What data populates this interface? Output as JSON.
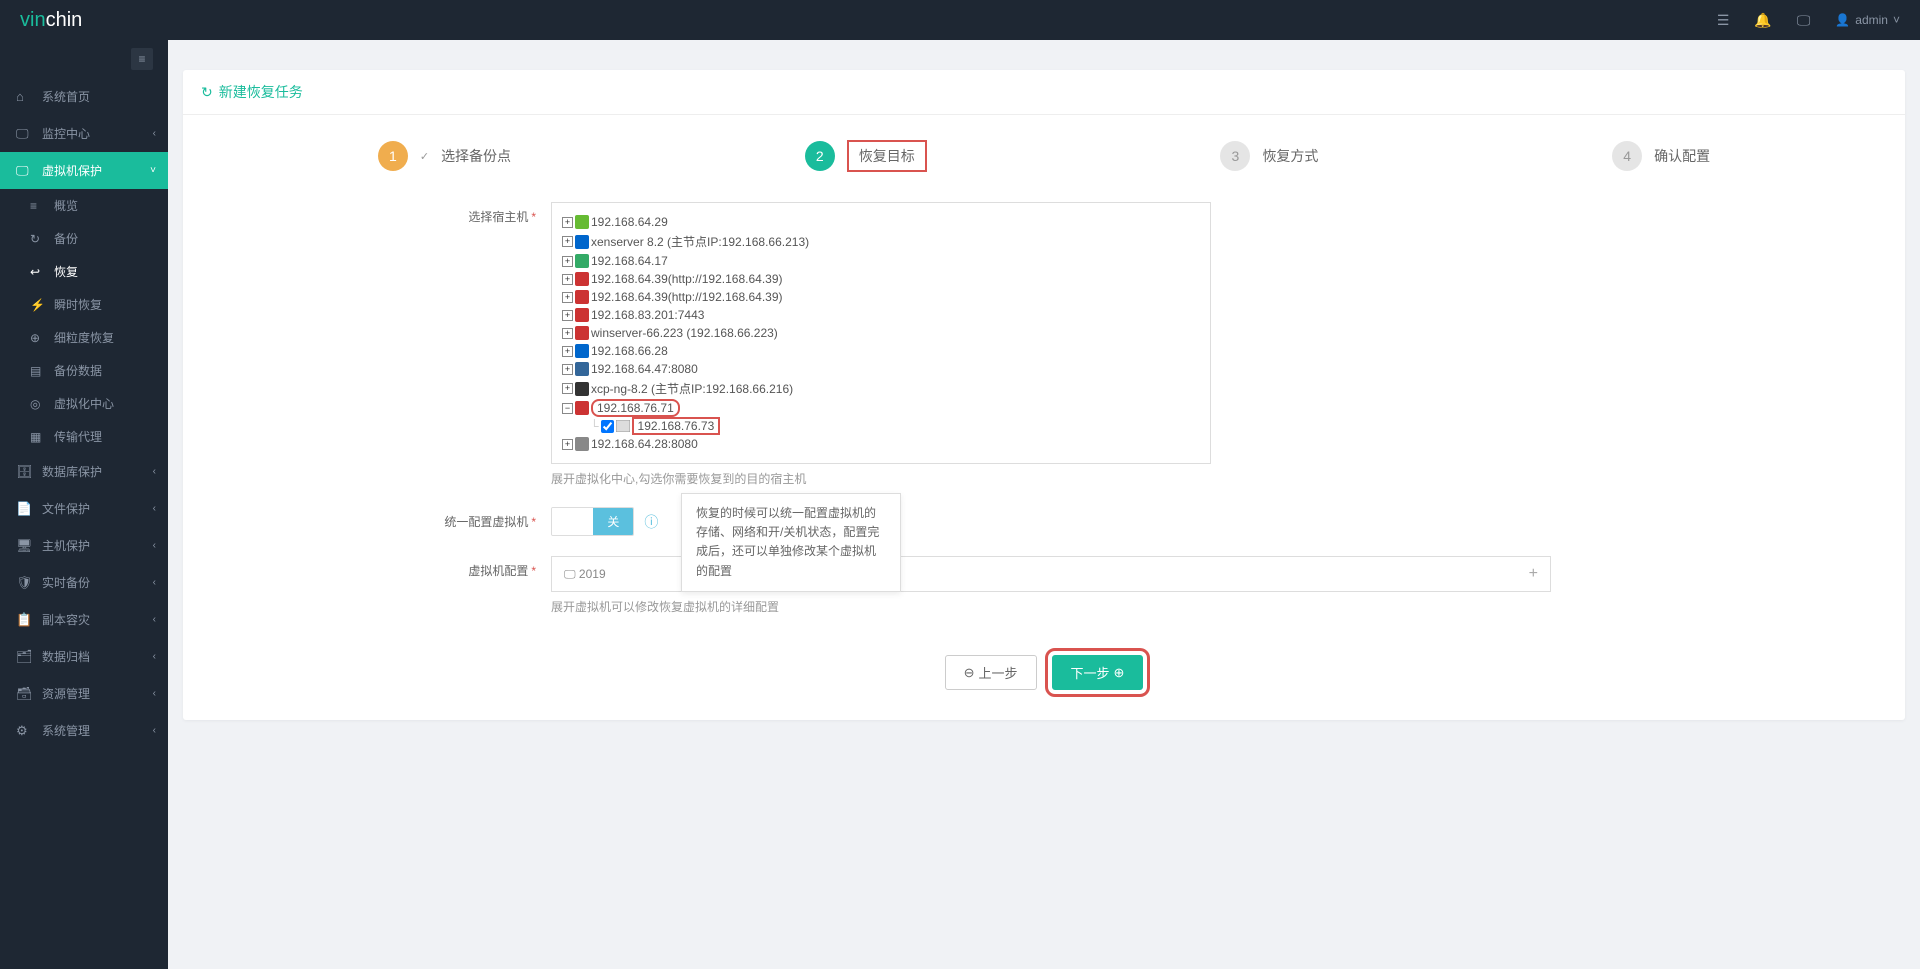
{
  "header": {
    "logo_a": "vin",
    "logo_b": "chin",
    "user": "admin"
  },
  "sidebar": {
    "items": [
      {
        "icon": "home",
        "label": "系统首页"
      },
      {
        "icon": "monitor",
        "label": "监控中心",
        "chevron": "‹"
      },
      {
        "icon": "monitor",
        "label": "虚拟机保护",
        "chevron": "˅",
        "active": true
      },
      {
        "icon": "db",
        "label": "数据库保护",
        "chevron": "‹"
      },
      {
        "icon": "doc",
        "label": "文件保护",
        "chevron": "‹"
      },
      {
        "icon": "host",
        "label": "主机保护",
        "chevron": "‹"
      },
      {
        "icon": "shield",
        "label": "实时备份",
        "chevron": "‹"
      },
      {
        "icon": "copy",
        "label": "副本容灾",
        "chevron": "‹"
      },
      {
        "icon": "archive",
        "label": "数据归档",
        "chevron": "‹"
      },
      {
        "icon": "res",
        "label": "资源管理",
        "chevron": "‹"
      },
      {
        "icon": "gear",
        "label": "系统管理",
        "chevron": "‹"
      }
    ],
    "submenu": [
      {
        "icon": "≡",
        "label": "概览"
      },
      {
        "icon": "↻",
        "label": "备份"
      },
      {
        "icon": "↩",
        "label": "恢复",
        "active": true
      },
      {
        "icon": "⚡",
        "label": "瞬时恢复"
      },
      {
        "icon": "⊕",
        "label": "细粒度恢复"
      },
      {
        "icon": "▤",
        "label": "备份数据"
      },
      {
        "icon": "◎",
        "label": "虚拟化中心"
      },
      {
        "icon": "▦",
        "label": "传输代理"
      }
    ]
  },
  "page_title": "新建恢复任务",
  "steps": [
    {
      "num": "1",
      "label": "选择备份点",
      "done": true
    },
    {
      "num": "2",
      "label": "恢复目标",
      "active": true,
      "highlight": true
    },
    {
      "num": "3",
      "label": "恢复方式"
    },
    {
      "num": "4",
      "label": "确认配置"
    }
  ],
  "form": {
    "host_label": "选择宿主机",
    "config_label": "统一配置虚拟机",
    "vm_label": "虚拟机配置",
    "toggle_off": "关",
    "tooltip": "恢复的时候可以统一配置虚拟机的存储、网络和开/关机状态，配置完成后，还可以单独修改某个虚拟机的配置",
    "host_hint": "展开虚拟化中心,勾选你需要恢复到的目的宿主机",
    "vm_hint": "展开虚拟机可以修改恢复虚拟机的详细配置",
    "vm_item": "2019"
  },
  "tree": [
    {
      "label": "192.168.64.29"
    },
    {
      "label": "xenserver 8.2 (主节点IP:192.168.66.213)"
    },
    {
      "label": "192.168.64.17"
    },
    {
      "label": "192.168.64.39(http://192.168.64.39)"
    },
    {
      "label": "192.168.64.39(http://192.168.64.39)"
    },
    {
      "label": "192.168.83.201:7443"
    },
    {
      "label": "winserver-66.223 (192.168.66.223)"
    },
    {
      "label": "192.168.66.28"
    },
    {
      "label": "192.168.64.47:8080"
    },
    {
      "label": "xcp-ng-8.2 (主节点IP:192.168.66.216)"
    },
    {
      "label": "192.168.76.71",
      "expanded": true,
      "highlight": true,
      "children": [
        {
          "label": "192.168.76.73",
          "highlight": true
        }
      ]
    },
    {
      "label": "192.168.64.28:8080"
    }
  ],
  "buttons": {
    "prev": "上一步",
    "next": "下一步"
  }
}
